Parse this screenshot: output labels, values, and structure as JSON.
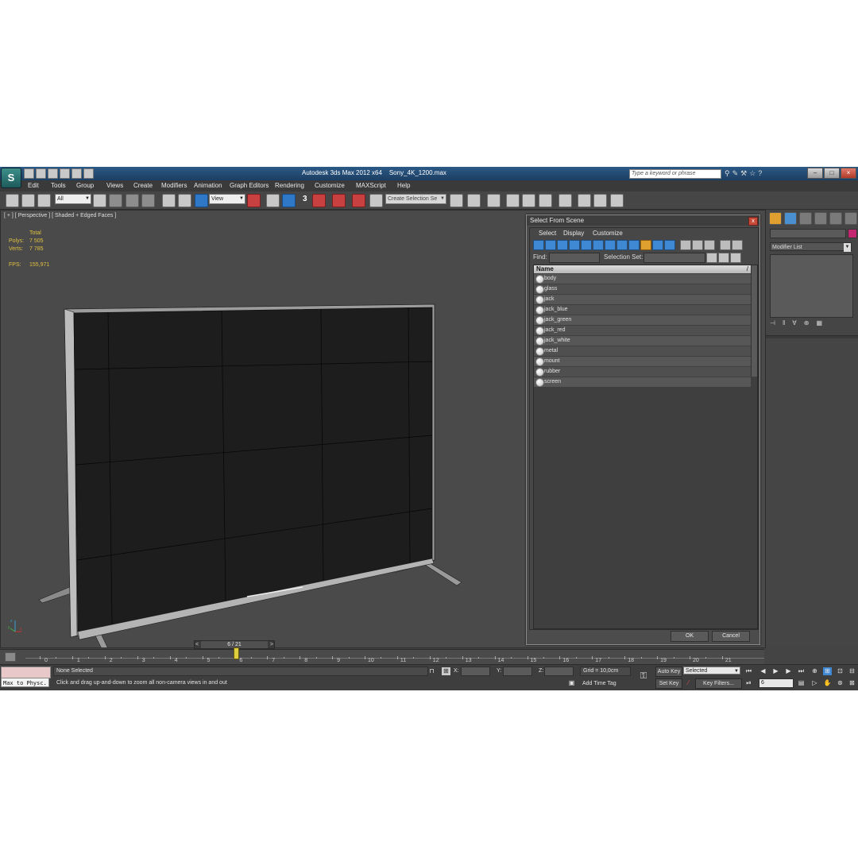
{
  "window": {
    "app_title": "Autodesk 3ds Max  2012 x64",
    "file_name": "Sony_4K_1200.max",
    "search_placeholder": "Type a keyword or phrase",
    "logo_glyph": "S"
  },
  "menubar": {
    "items": [
      "Edit",
      "Tools",
      "Group",
      "Views",
      "Create",
      "Modifiers",
      "Animation",
      "Graph Editors",
      "Rendering",
      "Customize",
      "MAXScript",
      "Help"
    ]
  },
  "toolbar": {
    "selection_filter": "All",
    "reference_coord": "View",
    "named_selection_placeholder": "Create Selection Se",
    "snap_label": "3"
  },
  "viewport": {
    "label": "[ + ] [ Perspective ] [ Shaded + Edged Faces ]",
    "stats": {
      "header": "Total",
      "polys_label": "Polys:",
      "polys_value": "7 505",
      "verts_label": "Verts:",
      "verts_value": "7 785",
      "fps_label": "FPS:",
      "fps_value": "155,971"
    },
    "axis_labels": {
      "x": "x",
      "y": "y",
      "z": "z"
    }
  },
  "dialog": {
    "title": "Select From Scene",
    "close_glyph": "x",
    "menu": [
      "Select",
      "Display",
      "Customize"
    ],
    "find_label": "Find:",
    "selection_set_label": "Selection Set:",
    "column_header": "Name",
    "sort_glyph": "/",
    "objects": [
      "body",
      "glass",
      "jack",
      "jack_blue",
      "jack_green",
      "jack_red",
      "jack_white",
      "metal",
      "mount",
      "rubber",
      "screen"
    ],
    "ok_label": "OK",
    "cancel_label": "Cancel"
  },
  "command_panel": {
    "modifier_list_label": "Modifier List",
    "accent_color": "#c2266e"
  },
  "timeline": {
    "frame_display": "6 / 21",
    "prev_glyph": "<",
    "next_glyph": ">",
    "ticks": [
      "0",
      "1",
      "2",
      "3",
      "4",
      "5",
      "6",
      "7",
      "8",
      "9",
      "10",
      "11",
      "12",
      "13",
      "14",
      "15",
      "16",
      "17",
      "18",
      "19",
      "20",
      "21"
    ]
  },
  "statusbar": {
    "maxscript_text": "Max to Physc.",
    "selection_status": "None Selected",
    "prompt": "Click and drag up-and-down to zoom all non-camera views in and out",
    "x_label": "X:",
    "y_label": "Y:",
    "z_label": "Z:",
    "grid": "Grid = 10,0cm",
    "add_time_tag": "Add Time Tag",
    "auto_key": "Auto Key",
    "set_key": "Set Key",
    "key_filters": "Key Filters...",
    "selected_option": "Selected",
    "current_frame": "6"
  }
}
